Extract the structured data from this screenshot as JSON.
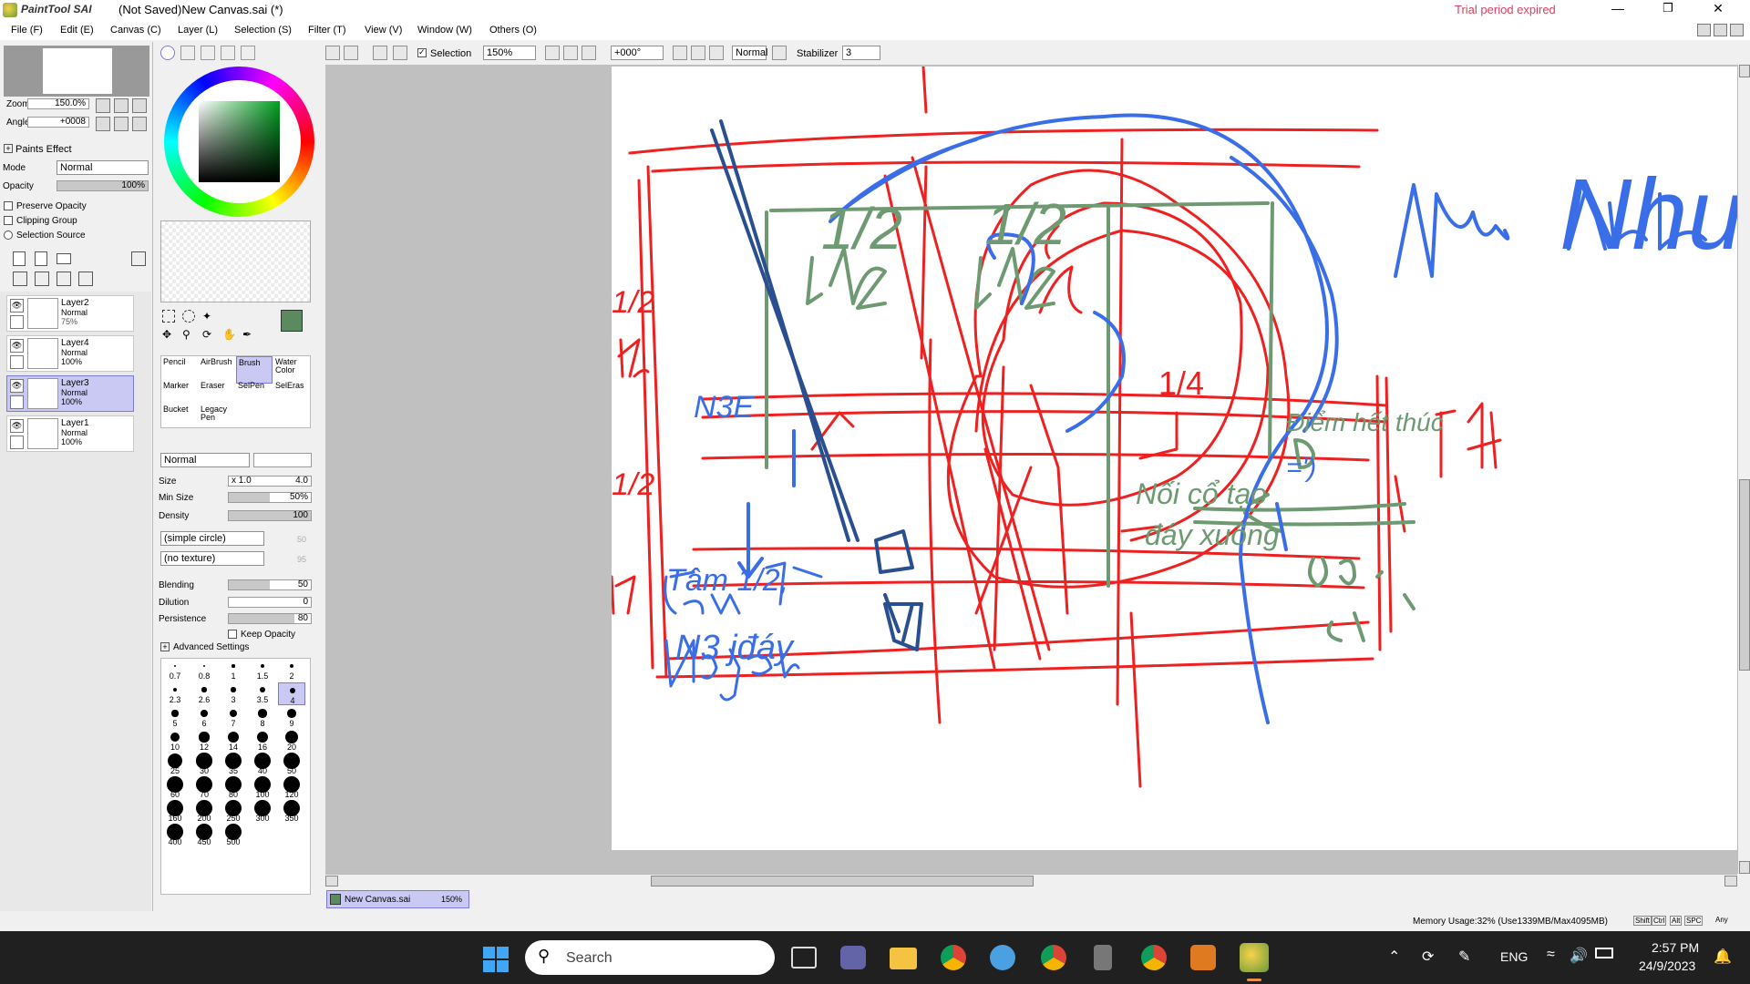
{
  "app": {
    "logo_text": "PaintTool SAI",
    "title": "(Not Saved)New Canvas.sai (*)",
    "trial_text": "Trial period expired"
  },
  "menu": [
    "File (F)",
    "Edit (E)",
    "Canvas (C)",
    "Layer (L)",
    "Selection (S)",
    "Filter (T)",
    "View (V)",
    "Window (W)",
    "Others (O)"
  ],
  "toolbar": {
    "selection_label": "Selection",
    "zoom_value": "150%",
    "angle_value": "+000°",
    "mode_value": "Normal",
    "stabilizer_label": "Stabilizer",
    "stabilizer_value": "3"
  },
  "navigator": {
    "zoom_label": "Zoom",
    "zoom_value": "150.0%",
    "angle_label": "Angle",
    "angle_value": "+0008"
  },
  "paints_effect": {
    "header": "Paints Effect",
    "mode_label": "Mode",
    "mode_value": "Normal",
    "opacity_label": "Opacity",
    "opacity_value": "100%",
    "opacity_level": 1.0,
    "preserve_opacity": "Preserve Opacity",
    "clipping_group": "Clipping Group",
    "selection_source": "Selection Source"
  },
  "layers": [
    {
      "name": "Layer2",
      "mode": "Normal",
      "opacity": "75%",
      "selected": false
    },
    {
      "name": "Layer4",
      "mode": "Normal",
      "opacity": "100%",
      "selected": false
    },
    {
      "name": "Layer3",
      "mode": "Normal",
      "opacity": "100%",
      "selected": true
    },
    {
      "name": "Layer1",
      "mode": "Normal",
      "opacity": "100%",
      "selected": false
    }
  ],
  "tools": [
    {
      "label": "Pencil"
    },
    {
      "label": "AirBrush"
    },
    {
      "label": "Brush"
    },
    {
      "label": "Water Color"
    },
    {
      "label": "Marker"
    },
    {
      "label": "Eraser"
    },
    {
      "label": "SelPen"
    },
    {
      "label": "SelEras"
    },
    {
      "label": "Bucket"
    },
    {
      "label": "Legacy Pen"
    }
  ],
  "brush": {
    "blend_mode": "Normal",
    "size_label": "Size",
    "size_mult": "x 1.0",
    "size_value": "4.0",
    "min_size_label": "Min Size",
    "min_size_value": "50%",
    "min_size_level": 0.5,
    "density_label": "Density",
    "density_value": "100",
    "density_level": 1.0,
    "shape": "(simple circle)",
    "shape_value": "50",
    "texture": "(no texture)",
    "texture_value": "95",
    "blending_label": "Blending",
    "blending_value": "50",
    "blending_level": 0.5,
    "dilution_label": "Dilution",
    "dilution_value": "0",
    "dilution_level": 0,
    "persistence_label": "Persistence",
    "persistence_value": "80",
    "persistence_level": 0.8,
    "keep_opacity": "Keep Opacity",
    "advanced_settings": "Advanced Settings"
  },
  "brush_sizes": [
    "0.7",
    "0.8",
    "1",
    "1.5",
    "2",
    "2.3",
    "2.6",
    "3",
    "3.5",
    "4",
    "5",
    "6",
    "7",
    "8",
    "9",
    "10",
    "12",
    "14",
    "16",
    "20",
    "25",
    "30",
    "35",
    "40",
    "50",
    "60",
    "70",
    "80",
    "100",
    "120",
    "160",
    "200",
    "250",
    "300",
    "350",
    "400",
    "450",
    "500"
  ],
  "selected_brush_size": "4",
  "canvas_tab": {
    "name": "New Canvas.sai",
    "zoom": "150%"
  },
  "status": {
    "memory": "Memory Usage:32% (Use1339MB/Max4095MB)",
    "keys": [
      "Shift",
      "Ctrl",
      "Alt",
      "SPC"
    ],
    "any": "Any"
  },
  "canvas_text": {
    "half_top": "1/2",
    "half_right": "1/2",
    "left_half_a": "1/2",
    "left_half_b": "1/2",
    "quarter": "1/4",
    "n3e": "N3E",
    "diem_het_thuc": "Điểm hết thúc",
    "equals": "=')",
    "noi_co": "Nối cổ tạo",
    "day_xuong": "đáy xuống",
    "tam": "Tâm 1/2,",
    "n3_day": "N3 jđáy",
    "nhu": "Nhu"
  },
  "taskbar": {
    "search_placeholder": "Search",
    "lang": "ENG",
    "time": "2:57 PM",
    "date": "24/9/2023"
  },
  "colors": {
    "primary": "#5a8a5e",
    "secondary": "#1f5f20",
    "red_stroke": "#ee2020",
    "blue_stroke": "#3a6ee8",
    "green_stroke": "#6e9a72",
    "navy_stroke": "#2a4f90",
    "trial_red": "#e04060"
  }
}
